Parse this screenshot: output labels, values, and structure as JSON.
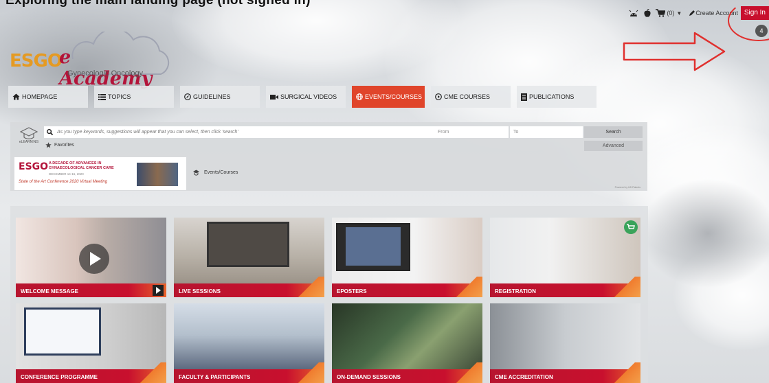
{
  "caption": "Exploring the main landing page (not signed in)",
  "topbar": {
    "android_icon": "android-icon",
    "apple_icon": "apple-icon",
    "cart_label": "(0)",
    "create_account": "Create Account",
    "sign_in": "Sign In",
    "badge": "4"
  },
  "logo": {
    "esgo": "ESGO",
    "eacademy": "e Academy",
    "subtitle": "Gynecologic Oncology"
  },
  "nav": [
    {
      "label": "HOMEPAGE",
      "icon": "home-icon"
    },
    {
      "label": "TOPICS",
      "icon": "list-icon"
    },
    {
      "label": "GUIDELINES",
      "icon": "compass-icon"
    },
    {
      "label": "SURGICAL VIDEOS",
      "icon": "video-icon"
    },
    {
      "label": "EVENTS/COURSES",
      "icon": "globe-icon"
    },
    {
      "label": "CME COURSES",
      "icon": "play-circle-icon"
    },
    {
      "label": "PUBLICATIONS",
      "icon": "document-icon"
    }
  ],
  "search": {
    "placeholder": "As you type keywords, suggestions will appear that you can select, then click 'search'",
    "from": "From",
    "to": "To",
    "search_button": "Search",
    "advanced": "Advanced",
    "favorites": "Favorites",
    "elearning": "eLEARNING",
    "powered": "Powered by UD Patents"
  },
  "banner": {
    "esgo": "ESGO",
    "title": "A DECADE OF ADVANCES IN GYNAECOLOGICAL CANCER CARE",
    "dates": "DECEMBER 14-16, 2020",
    "tagline": "State of the Art Conference 2020  Virtual Meeting"
  },
  "breadcrumb": "Events/Courses",
  "tiles": [
    {
      "label": "WELCOME MESSAGE"
    },
    {
      "label": "LIVE SESSIONS"
    },
    {
      "label": "EPOSTERS"
    },
    {
      "label": "REGISTRATION"
    },
    {
      "label": "CONFERENCE PROGRAMME"
    },
    {
      "label": "FACULTY & PARTICIPANTS"
    },
    {
      "label": "ON-DEMAND SESSIONS"
    },
    {
      "label": "CME ACCREDITATION"
    }
  ],
  "colors": {
    "accent": "#c8102e",
    "active_nav": "#e0452b",
    "logo_orange": "#e59a22"
  }
}
